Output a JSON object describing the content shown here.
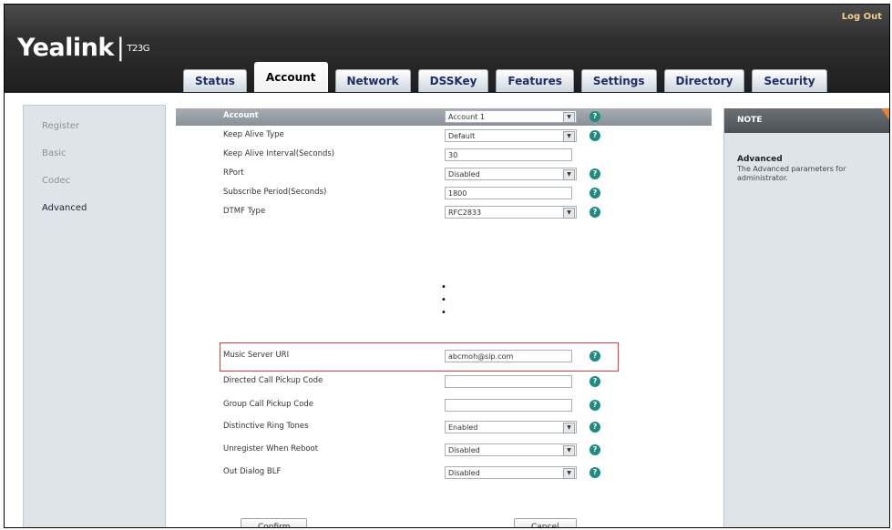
{
  "header": {
    "logo_name": "Yealink",
    "logo_sep": "|",
    "logo_model": "T23G",
    "logout": "Log Out"
  },
  "tabs": [
    {
      "label": "Status",
      "active": false
    },
    {
      "label": "Account",
      "active": true
    },
    {
      "label": "Network",
      "active": false
    },
    {
      "label": "DSSKey",
      "active": false
    },
    {
      "label": "Features",
      "active": false
    },
    {
      "label": "Settings",
      "active": false
    },
    {
      "label": "Directory",
      "active": false
    },
    {
      "label": "Security",
      "active": false
    }
  ],
  "sidebar": {
    "items": [
      {
        "label": "Register"
      },
      {
        "label": "Basic"
      },
      {
        "label": "Codec"
      },
      {
        "label": "Advanced"
      }
    ]
  },
  "form": {
    "header_label": "Account",
    "header_value": "Account 1",
    "rows": [
      {
        "label": "Keep Alive Type",
        "value": "Default"
      },
      {
        "label": "Keep Alive Interval(Seconds)",
        "value": "30"
      },
      {
        "label": "RPort",
        "value": "Disabled"
      },
      {
        "label": "Subscribe Period(Seconds)",
        "value": "1800"
      },
      {
        "label": "DTMF Type",
        "value": "RFC2833"
      },
      {
        "label": "Music Server URI",
        "value": "abcmoh@sip.com"
      },
      {
        "label": "Directed Call Pickup Code",
        "value": ""
      },
      {
        "label": "Group Call Pickup Code",
        "value": ""
      },
      {
        "label": "Distinctive Ring Tones",
        "value": "Enabled"
      },
      {
        "label": "Unregister When Reboot",
        "value": "Disabled"
      },
      {
        "label": "Out Dialog BLF",
        "value": "Disabled"
      }
    ],
    "help_glyph": "?",
    "arrow_glyph": "▼",
    "dots": [
      "•",
      "•",
      "•"
    ],
    "confirm": "Confirm",
    "cancel": "Cancel"
  },
  "note": {
    "heading": "NOTE",
    "title": "Advanced",
    "body": "The Advanced parameters for administrator."
  }
}
